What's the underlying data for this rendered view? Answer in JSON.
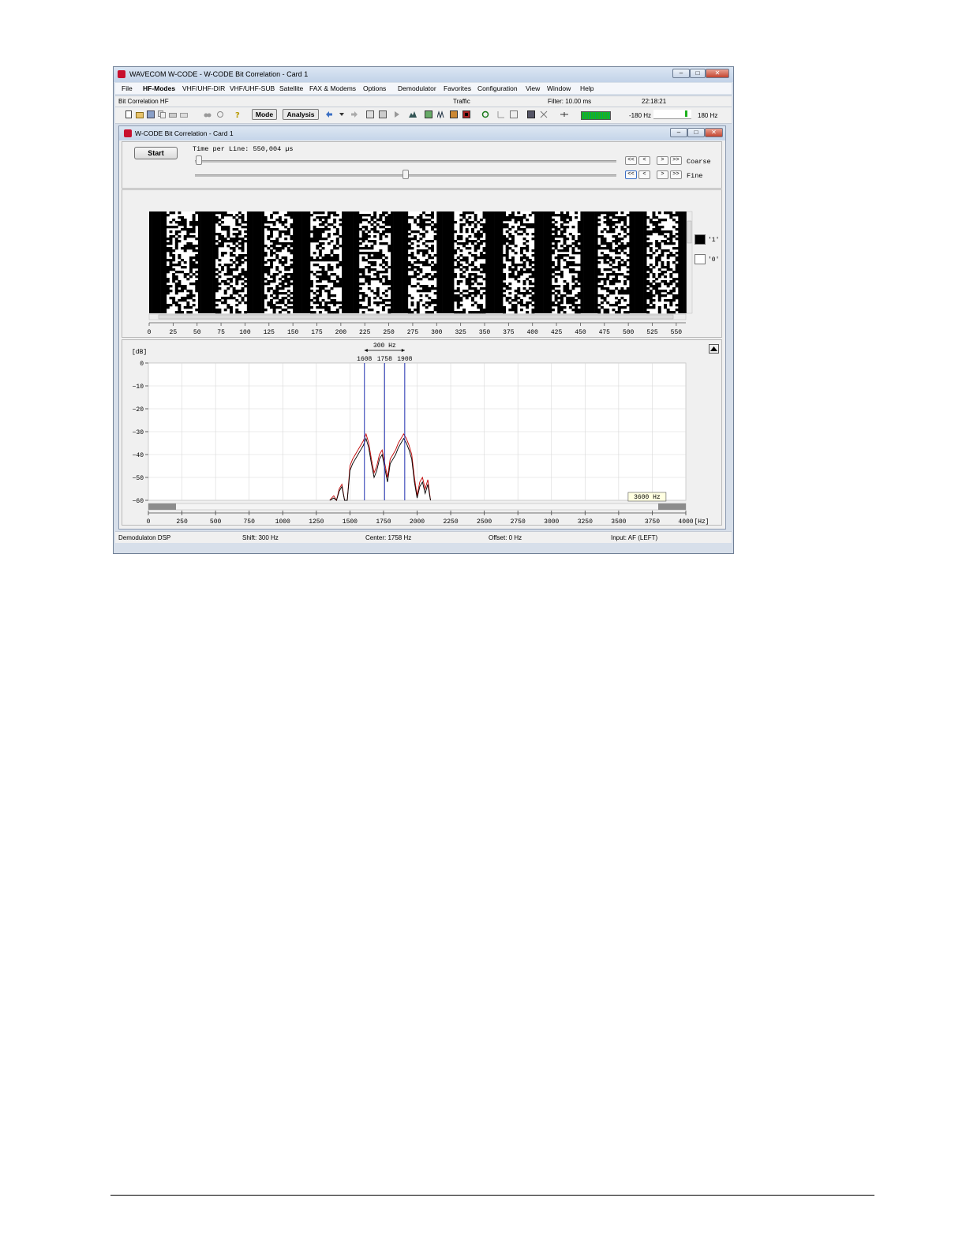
{
  "window": {
    "title": "WAVECOM W-CODE - W-CODE Bit Correlation  - Card 1",
    "controls": [
      "minimize-icon",
      "maximize-icon",
      "close-icon"
    ]
  },
  "menu": [
    "File",
    "HF-Modes",
    "VHF/UHF-DIR",
    "VHF/UHF-SUB",
    "Satellite",
    "FAX & Modems",
    "Options",
    "Demodulator",
    "Favorites",
    "Configuration",
    "View",
    "Window",
    "Help"
  ],
  "status_top": {
    "mode": "Bit Correlation HF",
    "traffic": "Traffic",
    "filter": "Filter: 10.00 ms",
    "time": "22:18:21"
  },
  "toolbar": {
    "mode_label": "Mode",
    "analysis_label": "Analysis",
    "offset_left": "-180 Hz",
    "offset_right": "180 Hz"
  },
  "inner_window": {
    "title": "W-CODE Bit Correlation  - Card 1"
  },
  "controls": {
    "start_label": "Start",
    "time_per_line": "Time per Line: 550,004 µs",
    "coarse_label": "Coarse",
    "fine_label": "Fine",
    "nav_labels": [
      "<<",
      "<",
      ">",
      ">>"
    ],
    "coarse_position": 0.01,
    "fine_position": 0.5
  },
  "bit_display": {
    "x_ticks": [
      "0",
      "25",
      "50",
      "75",
      "100",
      "125",
      "150",
      "175",
      "200",
      "225",
      "250",
      "275",
      "300",
      "325",
      "350",
      "375",
      "400",
      "425",
      "450",
      "475",
      "500",
      "525",
      "550"
    ],
    "legend": [
      {
        "label": "'1'",
        "color": "#000000"
      },
      {
        "label": "'0'",
        "color": "#ffffff"
      }
    ],
    "period_bits": 50,
    "visible_bits": 560,
    "rows": 43
  },
  "chart_data": {
    "type": "line",
    "ylabel": "[dB]",
    "xlabel": "[Hz]",
    "xlim": [
      0,
      4000
    ],
    "ylim": [
      -60,
      0
    ],
    "x_ticks": [
      0,
      250,
      500,
      750,
      1000,
      1250,
      1500,
      1750,
      2000,
      2250,
      2500,
      2750,
      3000,
      3250,
      3500,
      3750,
      4000
    ],
    "y_ticks": [
      0,
      -10,
      -20,
      -30,
      -40,
      -50,
      -60
    ],
    "grid": true,
    "markers": [
      {
        "label": "1608",
        "x": 1608
      },
      {
        "label": "1758",
        "x": 1758
      },
      {
        "label": "1908",
        "x": 1908
      }
    ],
    "shift_label": "300 Hz",
    "cursor_label": "3600 Hz",
    "series": [
      {
        "color": "#c00000",
        "x": [
          1350,
          1380,
          1400,
          1420,
          1440,
          1460,
          1480,
          1500,
          1520,
          1540,
          1560,
          1580,
          1600,
          1620,
          1640,
          1660,
          1680,
          1700,
          1720,
          1740,
          1760,
          1780,
          1800,
          1820,
          1840,
          1860,
          1880,
          1900,
          1920,
          1940,
          1960,
          1980,
          2000,
          2020,
          2040,
          2060,
          2080,
          2100
        ],
        "y": [
          -60,
          -58,
          -60,
          -55,
          -53,
          -60,
          -60,
          -45,
          -42,
          -40,
          -38,
          -36,
          -34,
          -31,
          -35,
          -42,
          -48,
          -45,
          -40,
          -38,
          -44,
          -50,
          -42,
          -40,
          -38,
          -35,
          -33,
          -31,
          -33,
          -36,
          -40,
          -50,
          -58,
          -52,
          -50,
          -55,
          -51,
          -60
        ]
      },
      {
        "color": "#000000",
        "x": [
          1350,
          1380,
          1400,
          1420,
          1440,
          1460,
          1480,
          1500,
          1520,
          1540,
          1560,
          1580,
          1600,
          1620,
          1640,
          1660,
          1680,
          1700,
          1720,
          1740,
          1760,
          1780,
          1800,
          1820,
          1840,
          1860,
          1880,
          1900,
          1920,
          1940,
          1960,
          1980,
          2000,
          2020,
          2040,
          2060,
          2080,
          2100
        ],
        "y": [
          -60,
          -59,
          -60,
          -56,
          -54,
          -60,
          -60,
          -47,
          -44,
          -42,
          -40,
          -38,
          -36,
          -33,
          -37,
          -44,
          -50,
          -47,
          -42,
          -40,
          -46,
          -52,
          -44,
          -42,
          -40,
          -37,
          -35,
          -33,
          -35,
          -38,
          -42,
          -52,
          -59,
          -54,
          -52,
          -57,
          -53,
          -60
        ]
      }
    ]
  },
  "status_bottom": {
    "demod": "Demodulaton DSP",
    "shift": "Shift: 300 Hz",
    "center": "Center: 1758 Hz",
    "offset": "Offset: 0 Hz",
    "input": "Input: AF (LEFT)"
  }
}
